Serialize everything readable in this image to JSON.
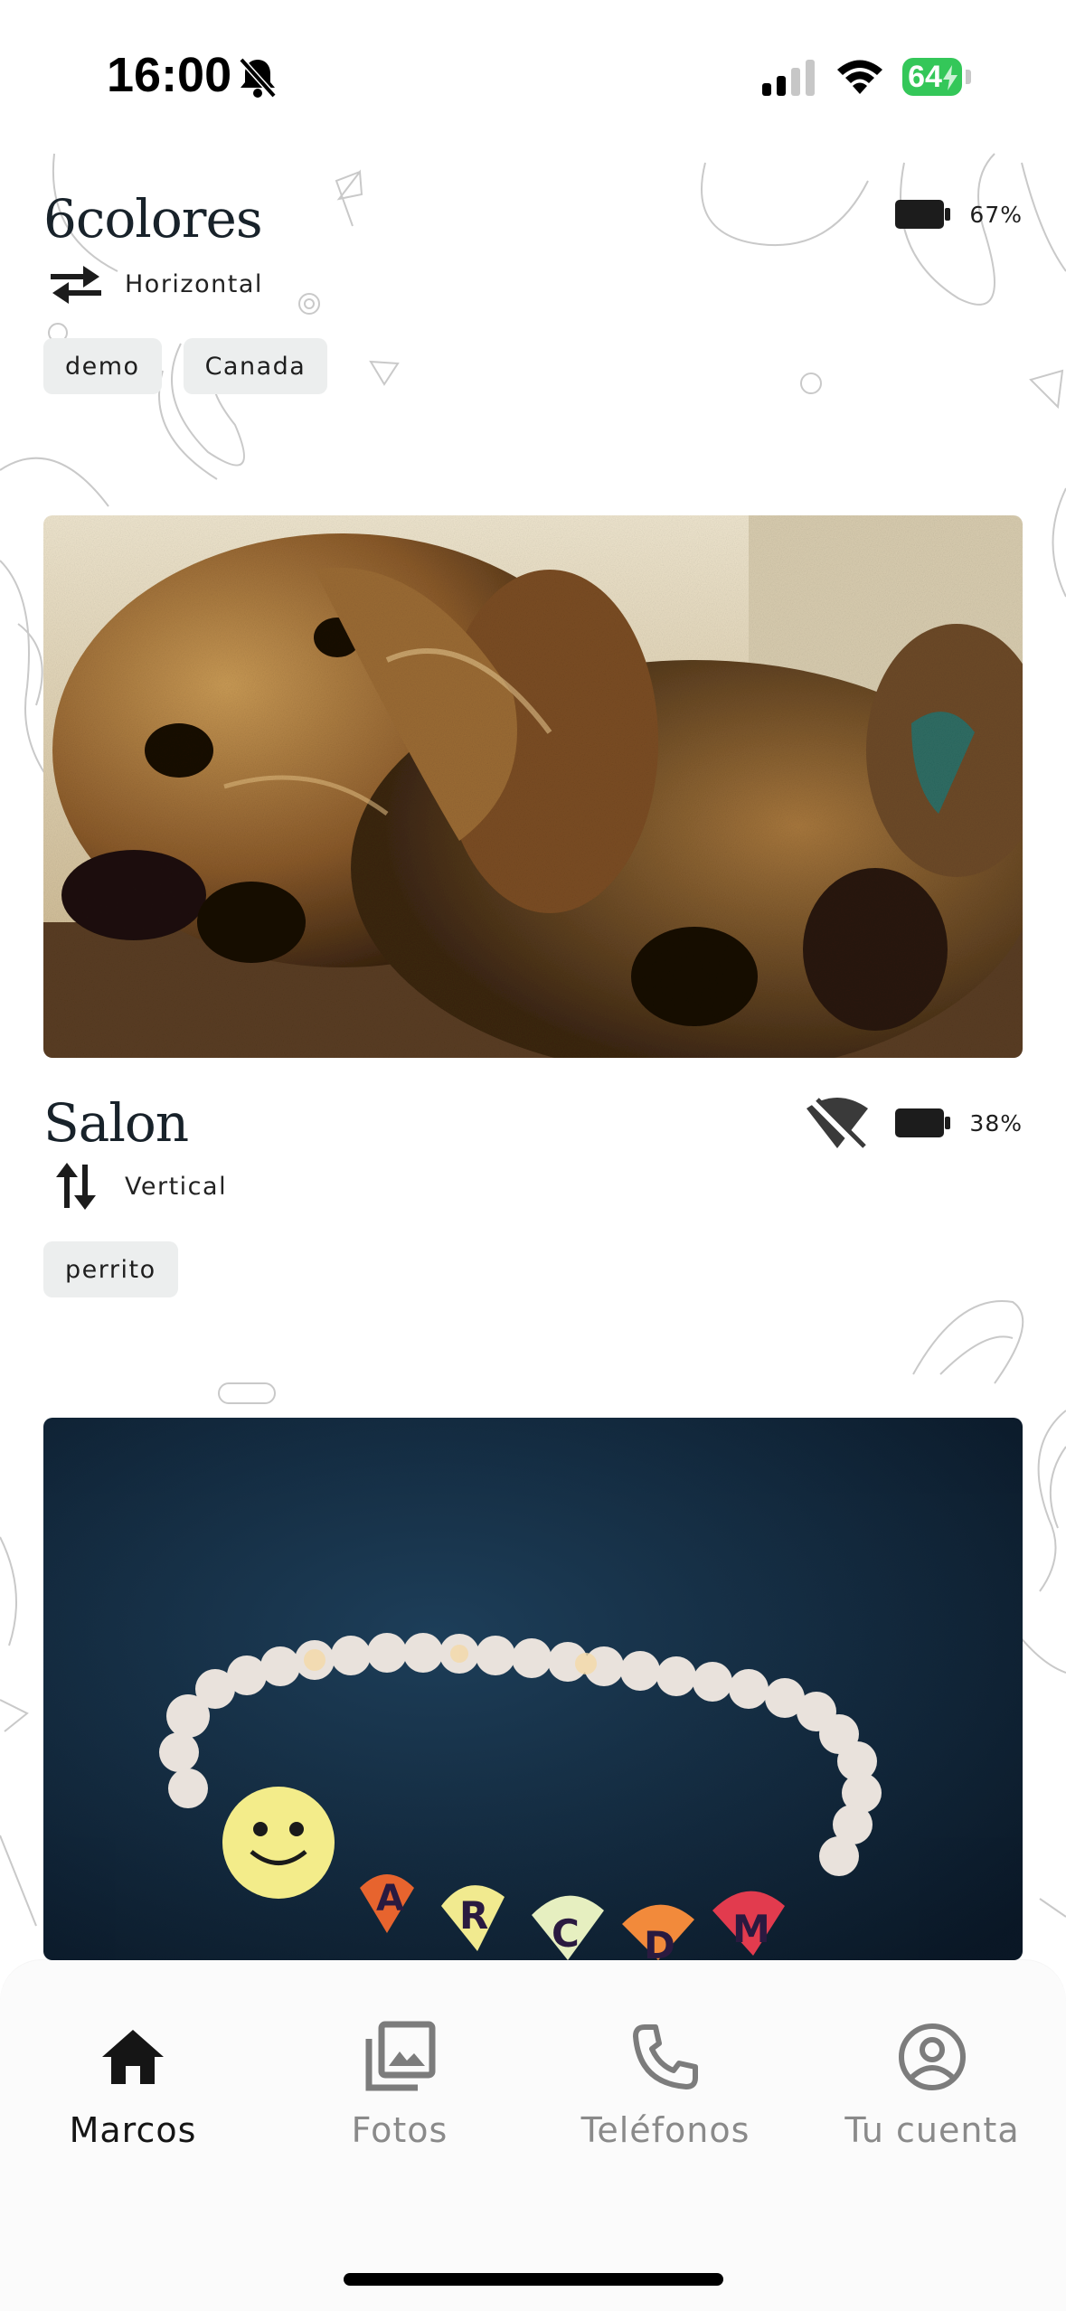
{
  "status_bar": {
    "time": "16:00",
    "battery": "64"
  },
  "frames": [
    {
      "title": "6colores",
      "orientation": "Horizontal",
      "orientation_icon": "swap-horizontal-icon",
      "tags": [
        "demo",
        "Canada"
      ],
      "battery": "67%",
      "wifi_offline": false,
      "photo": "dog-photo"
    },
    {
      "title": "Salon",
      "orientation": "Vertical",
      "orientation_icon": "swap-vertical-icon",
      "tags": [
        "perrito"
      ],
      "battery": "38%",
      "wifi_offline": true,
      "photo": "bracelet-photo"
    }
  ],
  "nav": {
    "items": [
      {
        "label": "Marcos",
        "icon": "home-icon",
        "active": true
      },
      {
        "label": "Fotos",
        "icon": "photo-library-icon",
        "active": false
      },
      {
        "label": "Teléfonos",
        "icon": "phone-icon",
        "active": false
      },
      {
        "label": "Tu cuenta",
        "icon": "account-circle-icon",
        "active": false
      }
    ]
  },
  "colors": {
    "active_nav": "#151515",
    "inactive_nav": "#8a8a8a",
    "tag_bg": "#eceeee",
    "status_battery": "#34c759"
  }
}
